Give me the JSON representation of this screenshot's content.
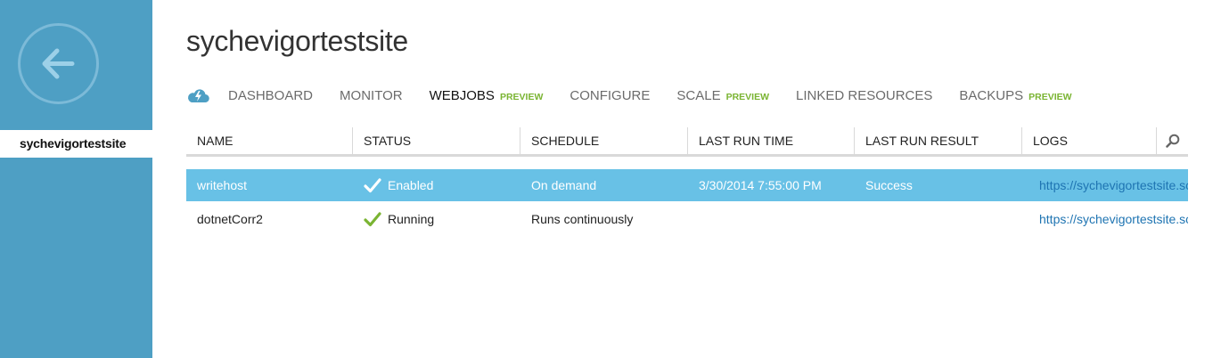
{
  "sidebar": {
    "back_label": "back",
    "items": [
      {
        "label": "sychevigortestsite"
      }
    ]
  },
  "page": {
    "title": "sychevigortestsite"
  },
  "nav": {
    "icon": "cloud-lightning-icon",
    "tabs": [
      {
        "label": "DASHBOARD",
        "badge": ""
      },
      {
        "label": "MONITOR",
        "badge": ""
      },
      {
        "label": "WEBJOBS",
        "badge": "PREVIEW",
        "active": true
      },
      {
        "label": "CONFIGURE",
        "badge": ""
      },
      {
        "label": "SCALE",
        "badge": "PREVIEW"
      },
      {
        "label": "LINKED RESOURCES",
        "badge": ""
      },
      {
        "label": "BACKUPS",
        "badge": "PREVIEW"
      }
    ]
  },
  "table": {
    "columns": [
      "NAME",
      "STATUS",
      "SCHEDULE",
      "LAST RUN TIME",
      "LAST RUN RESULT",
      "LOGS"
    ],
    "rows": [
      {
        "name": "writehost",
        "status": "Enabled",
        "schedule": "On demand",
        "last_run_time": "3/30/2014 7:55:00 PM",
        "last_run_result": "Success",
        "logs": "https://sychevigortestsite.sc",
        "selected": true
      },
      {
        "name": "dotnetCorr2",
        "status": "Running",
        "schedule": "Runs continuously",
        "last_run_time": "",
        "last_run_result": "",
        "logs": "https://sychevigortestsite.sc",
        "selected": false
      }
    ]
  },
  "colors": {
    "sidebar": "#4e9fc4",
    "selected_row": "#68c1e6",
    "preview_badge": "#7ab432",
    "check_green": "#7ab432",
    "link": "#1e74b2"
  }
}
